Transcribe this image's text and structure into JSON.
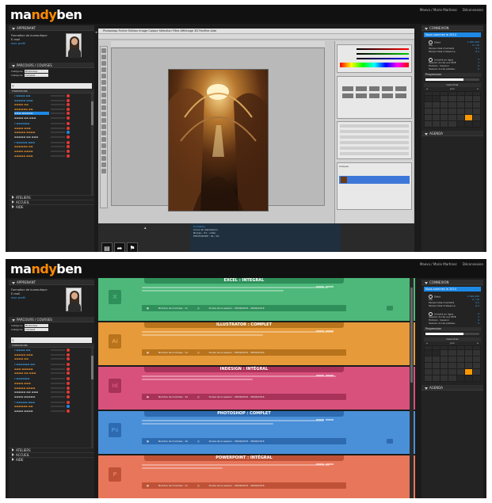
{
  "brand": {
    "name_part1": "ma",
    "name_part2": "ndy",
    "name_part3": "ben",
    "accent": "#ff8a00"
  },
  "header": {
    "user_text": "Maeva / Marie Martinez",
    "logout_text": "Déconnexion"
  },
  "screen1": {
    "sidebar": {
      "profile_header": "APPRENANT",
      "profile_name": "Formation de bureautique",
      "profile_role": "E-mail",
      "profile_link": "mon profil",
      "catalog_header": "PARCOURS / COURSES",
      "filter_label_1": "Catégorie",
      "filter_label_2": "Catégorie",
      "filter_val_1": "Photoshop",
      "filter_val_2": "Complet",
      "tree_header": "FORMATIONS",
      "collapsed_1": "ATELIERS",
      "collapsed_2": "ACCUEIL",
      "collapsed_3": "AIDE"
    },
    "photoshop": {
      "menu": "Photoshop   Fichier   Édition   Image   Calque   Sélection   Filtre   Affichage   3D   Fenêtre   Aide",
      "panel_label": "Calques"
    },
    "info": {
      "title": "Formation",
      "line1": "Cours et réalisations",
      "line2": "Niveau : 01 : vidéo",
      "line3": "PHOTOSHOP : 01 / 10"
    }
  },
  "screen2": {
    "courses": [
      {
        "title": "EXCEL : INTÉGRAL",
        "icon": "X",
        "color": "#4db87a",
        "dark": "#2f8f5a",
        "meta1": "Nombre de modules : 11",
        "meta2": "Durée de la session : 28/06/2015 - 28/06/2016"
      },
      {
        "title": "ILLUSTRATOR : COMPLET",
        "icon": "Ai",
        "color": "#e69a3a",
        "dark": "#b8731c",
        "meta1": "Nombre de modules : 14",
        "meta2": "Durée de la session : 28/06/2015 - 28/06/2016"
      },
      {
        "title": "INDESIGN : INTÉGRAL",
        "icon": "Id",
        "color": "#d8517d",
        "dark": "#a83259",
        "meta1": "Nombre de modules : 14",
        "meta2": "Durée de la session : 28/06/2015 - 28/06/2016"
      },
      {
        "title": "PHOTOSHOP : COMPLET",
        "icon": "Ps",
        "color": "#4a90d8",
        "dark": "#2d6ab0",
        "meta1": "Nombre de modules : 19",
        "meta2": "Durée de la session : 28/06/2015 - 28/06/2016"
      },
      {
        "title": "POWERPOINT : INTÉGRAL",
        "icon": "P",
        "color": "#e8765a",
        "dark": "#bf5236",
        "meta1": "Nombre de modules : 11",
        "meta2": "Durée de la session : 28/06/2015 - 28/06/2016"
      }
    ]
  },
  "right_panel": {
    "box1_title": "CONNEXION",
    "box1_sub": "Nous sommes le 2014",
    "rows": [
      {
        "label": "Débit",
        "value": "1 000 000"
      },
      {
        "label": "Vie",
        "value": "0 / 10"
      },
      {
        "label": "Temps total d'activité",
        "value": "0 h"
      },
      {
        "label": "Temps total d'absence",
        "value": "0 h"
      }
    ],
    "rows2": [
      {
        "label": "Activité en ligne",
        "value": "0"
      },
      {
        "label": "Session Accès aux EDE",
        "value": "1"
      },
      {
        "label": "Histoire : Session",
        "value": "0"
      },
      {
        "label": "Session Accès plateau",
        "value": "0"
      }
    ],
    "progress_label": "Progression",
    "progress_fraction": 0.7,
    "calendar_title": "Calendrier",
    "calendar_month": "Juin",
    "calendar_today_index": 26,
    "agenda_title": "AGENDA"
  }
}
